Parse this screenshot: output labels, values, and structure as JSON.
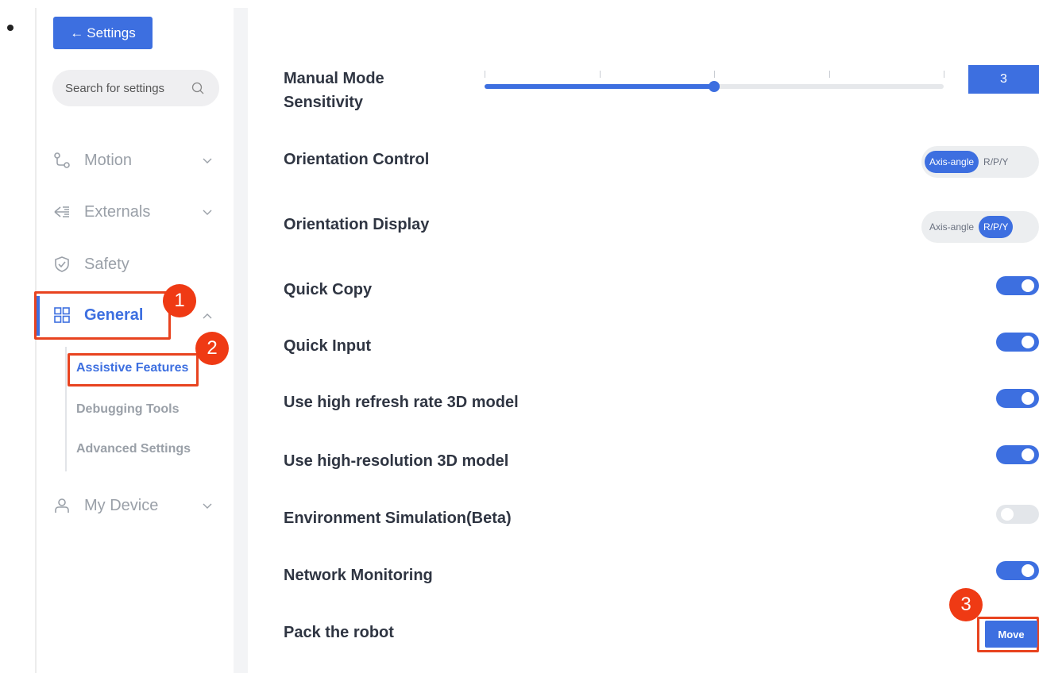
{
  "sidebar": {
    "back_label": "Settings",
    "search_placeholder": "Search for settings",
    "items": [
      {
        "label": "Motion"
      },
      {
        "label": "Externals"
      },
      {
        "label": "Safety"
      },
      {
        "label": "General"
      },
      {
        "label": "My Device"
      }
    ],
    "general_sub": [
      {
        "label": "Assistive Features"
      },
      {
        "label": "Debugging Tools"
      },
      {
        "label": "Advanced Settings"
      }
    ]
  },
  "badges": [
    "1",
    "2",
    "3"
  ],
  "settings": {
    "manual_mode": {
      "label_line1": "Manual Mode",
      "label_line2": "Sensitivity",
      "value": "3",
      "level": 0.5
    },
    "orientation_control": {
      "label": "Orientation Control",
      "options": [
        "Axis-angle",
        "R/P/Y"
      ],
      "selected": "Axis-angle"
    },
    "orientation_display": {
      "label": "Orientation Display",
      "options": [
        "Axis-angle",
        "R/P/Y"
      ],
      "selected": "R/P/Y"
    },
    "quick_copy": {
      "label": "Quick Copy",
      "on": true
    },
    "quick_input": {
      "label": "Quick Input",
      "on": true
    },
    "high_refresh": {
      "label": "Use high refresh rate 3D model",
      "on": true
    },
    "high_res": {
      "label": "Use high-resolution 3D model",
      "on": true
    },
    "env_sim": {
      "label": "Environment Simulation(Beta)",
      "on": false
    },
    "network": {
      "label": "Network Monitoring",
      "on": true
    },
    "pack": {
      "label": "Pack the robot",
      "button": "Move"
    }
  },
  "colors": {
    "accent": "#3d6fe0",
    "highlight": "#e8431f"
  }
}
